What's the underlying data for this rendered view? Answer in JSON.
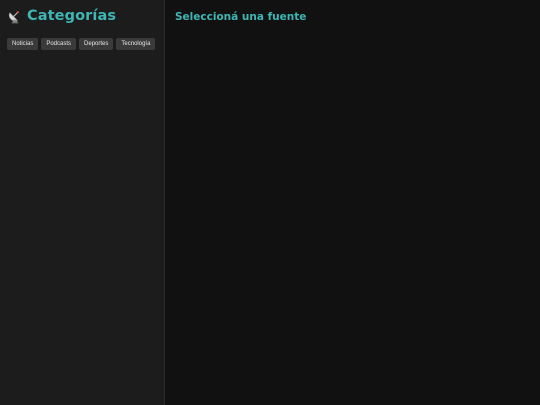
{
  "sidebar": {
    "title_icon": "satellite-antenna-icon",
    "title": "Categorías",
    "categories": [
      {
        "label": "Noticias"
      },
      {
        "label": "Podcasts"
      },
      {
        "label": "Deportes"
      },
      {
        "label": "Tecnología"
      }
    ]
  },
  "main": {
    "heading": "Seleccioná una fuente"
  },
  "colors": {
    "accent": "#3fb6b4",
    "sidebar_bg": "#1c1c1c",
    "main_bg": "#111111",
    "button_bg": "#3a3a3a"
  }
}
